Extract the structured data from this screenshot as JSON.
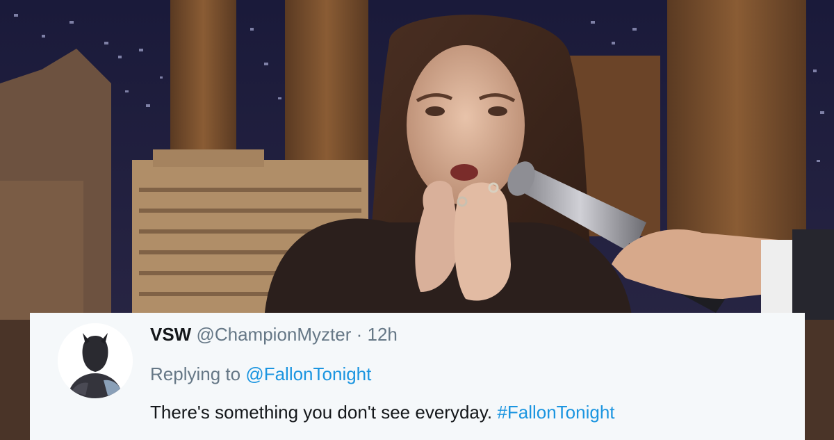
{
  "tweet": {
    "display_name": "VSW",
    "handle": "@ChampionMyzter",
    "separator": "·",
    "timestamp": "12h",
    "reply_prefix": "Replying to ",
    "reply_to": "@FallonTonight",
    "text": "There's something you don't see everyday. ",
    "hashtag": "#FallonTonight",
    "link_color": "#1b95e0"
  }
}
